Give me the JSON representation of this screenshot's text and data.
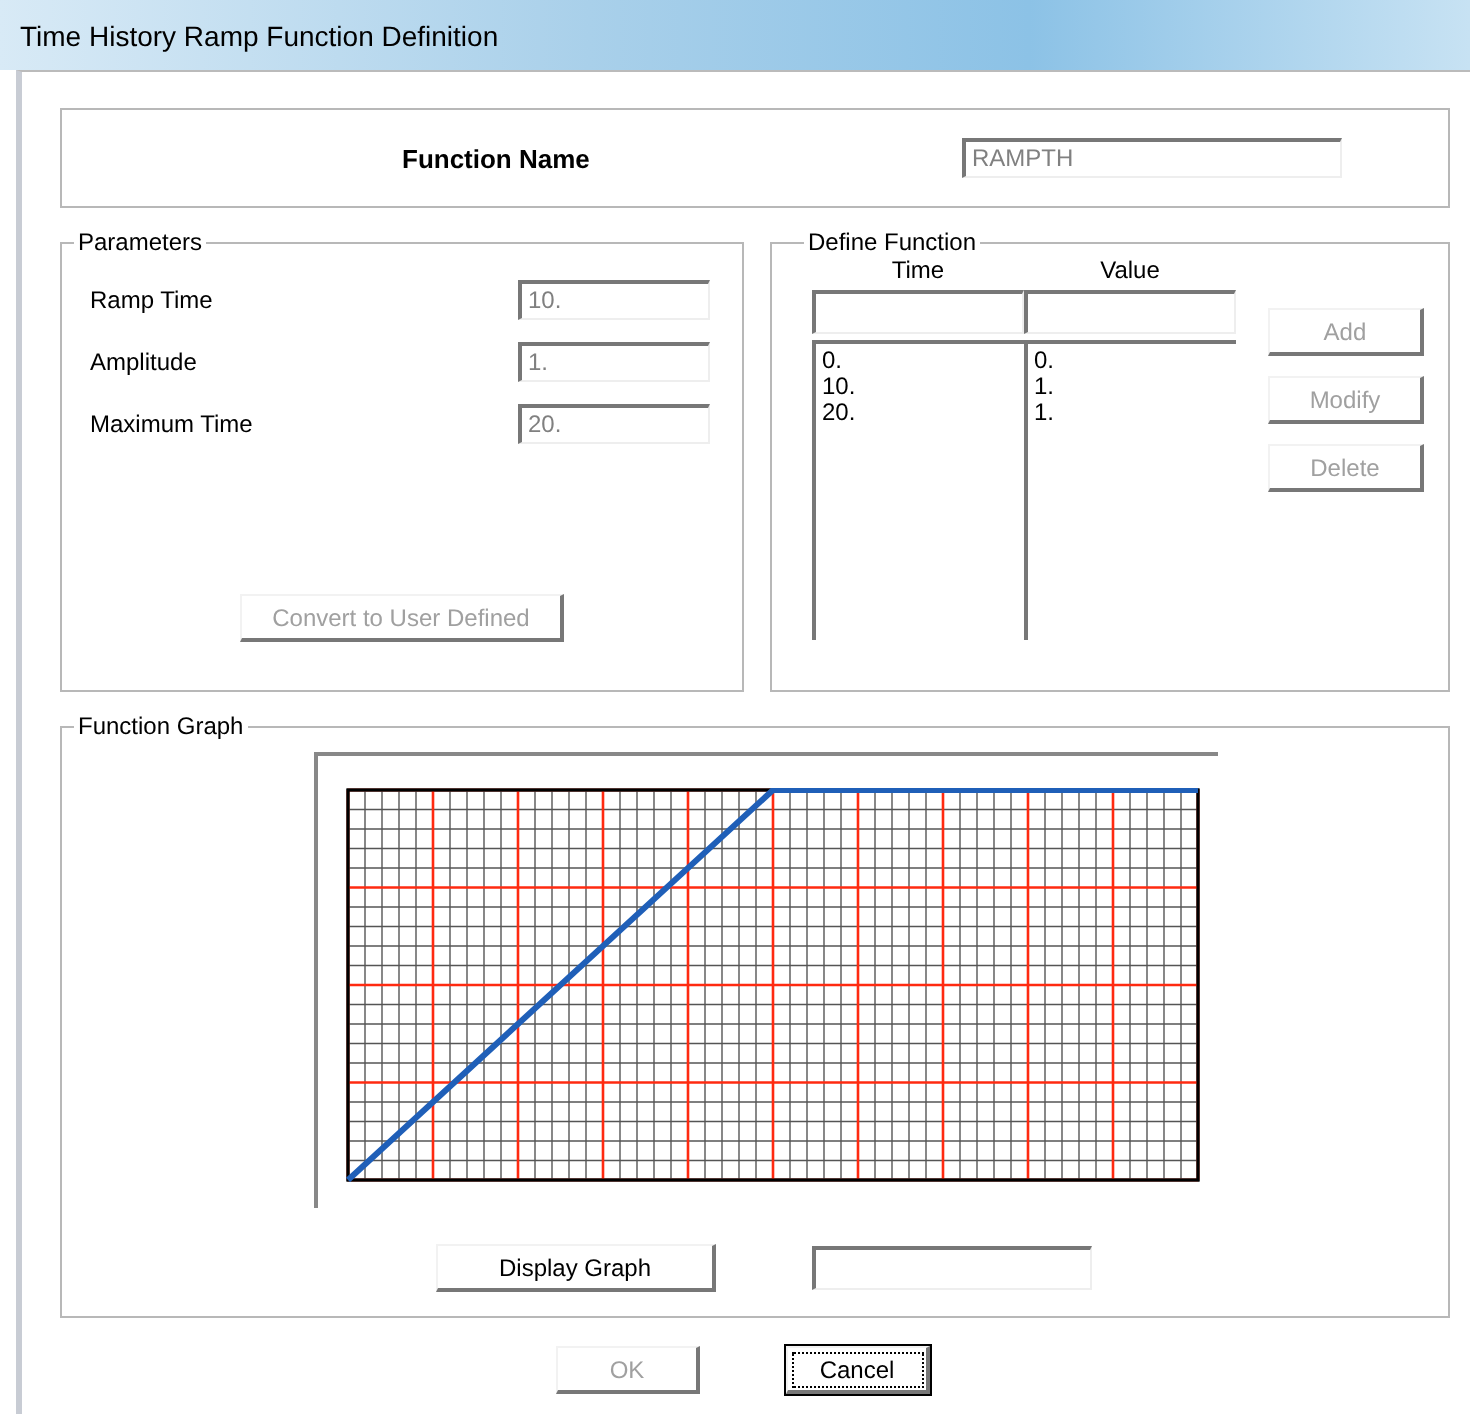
{
  "window": {
    "title": "Time History Ramp Function Definition"
  },
  "function_name": {
    "label": "Function Name",
    "value": "RAMPTH"
  },
  "parameters": {
    "title": "Parameters",
    "fields": [
      {
        "label": "Ramp Time",
        "value": "10.",
        "disabled": true
      },
      {
        "label": "Amplitude",
        "value": "1.",
        "disabled": true
      },
      {
        "label": "Maximum Time",
        "value": "20.",
        "disabled": true
      }
    ],
    "convert_button": {
      "label": "Convert to User Defined",
      "disabled": true
    }
  },
  "define_function": {
    "title": "Define Function",
    "columns": [
      {
        "heading": "Time",
        "rows": [
          "0.",
          "10.",
          "20."
        ]
      },
      {
        "heading": "Value",
        "rows": [
          "0.",
          "1.",
          "1."
        ]
      }
    ],
    "buttons": [
      {
        "label": "Add",
        "disabled": true
      },
      {
        "label": "Modify",
        "disabled": true
      },
      {
        "label": "Delete",
        "disabled": true
      }
    ]
  },
  "function_graph": {
    "title": "Function Graph",
    "display_button": {
      "label": "Display Graph",
      "disabled": false
    }
  },
  "buttons": [
    {
      "label": "OK",
      "disabled": true,
      "focused": false
    },
    {
      "label": "Cancel",
      "disabled": false,
      "focused": true
    }
  ]
}
